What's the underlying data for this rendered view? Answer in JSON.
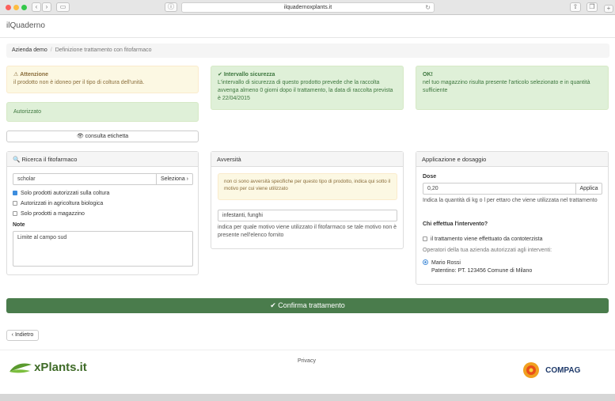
{
  "browser": {
    "url": "ilquadernoxplants.it"
  },
  "app": {
    "brand": "ilQuaderno"
  },
  "breadcrumb": {
    "home": "Azienda demo",
    "current": "Definizione trattamento con fitofarmaco"
  },
  "alerts": {
    "warning": {
      "title": "Attenzione",
      "text": "il prodotto non è idoneo per il tipo di coltura dell'unità."
    },
    "authorized": "Autorizzato",
    "interval": {
      "title": "Intervallo sicurezza",
      "text": "L'intervallo di sicurezza di questo prodotto prevede che la raccolta avvenga almeno 0 giorni dopo il trattamento, la data di raccolta prevista è 22/04/2015"
    },
    "stock": {
      "title": "OK!",
      "text": "nel tuo magazzino risulta presente l'articolo selezionato e in quantità sufficiente"
    }
  },
  "label_button": "consulta etichetta",
  "search_panel": {
    "title": "Ricerca il fitofarmaco",
    "query": "scholar",
    "select_label": "Seleziona",
    "filters": [
      {
        "label": "Solo prodotti autorizzati sulla coltura",
        "checked": true
      },
      {
        "label": "Autorizzati in agricoltura biologica",
        "checked": false
      },
      {
        "label": "Solo prodotti a magazzino",
        "checked": false
      }
    ],
    "notes_label": "Note",
    "notes_value": "Limite al campo sud"
  },
  "adversity_panel": {
    "title": "Avversità",
    "info": "non ci sono avversità specifiche per questo tipo di prodotto, indica qui sotto il motivo per cui viene utilizzato",
    "value": "infestanti, funghi",
    "help": "indica per quale motivo viene utilizzato il fitofarmaco se tale motivo non è presente nell'elenco fornito"
  },
  "dose_panel": {
    "title": "Applicazione e dosaggio",
    "dose_label": "Dose",
    "dose_value": "0,20",
    "apply_label": "Applica",
    "dose_help": "Indica la quantità di kg o l per ettaro che viene utilizzata nel trattamento",
    "who_label": "Chi effettua l'intervento?",
    "contractor_label": "il trattamento viene effettuato da contoterzista",
    "operators_label": "Operatori della tua azienda autorizzati agli interventi:",
    "operator_name": "Mario Rossi",
    "operator_license": "Patentino: PT. 123456 Comune di Milano"
  },
  "confirm_label": "Confirma trattamento",
  "back_label": "Indietro",
  "footer": {
    "privacy": "Privacy",
    "logo_left": "xPlants.it",
    "logo_right": "COMPAG"
  },
  "colors": {
    "success": "#4a7c4c",
    "warning_bg": "#fcf8e3",
    "ok_bg": "#dff0d8"
  }
}
